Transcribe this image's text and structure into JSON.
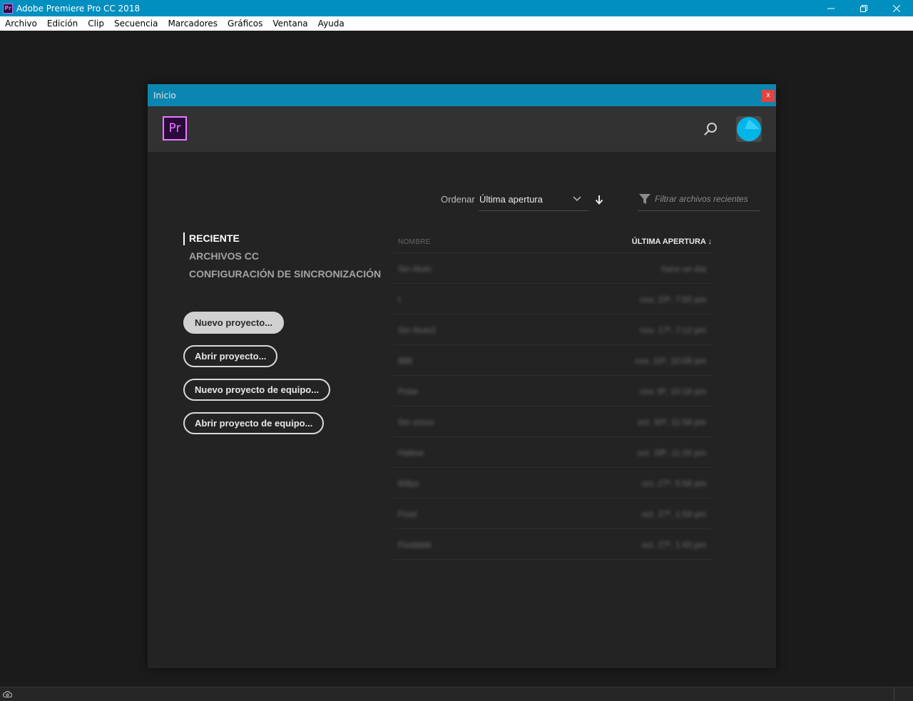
{
  "window": {
    "title": "Adobe Premiere Pro CC 2018",
    "app_icon_label": "Pr",
    "controls": [
      "minimize-icon",
      "restore-icon",
      "close-icon"
    ]
  },
  "menu": [
    "Archivo",
    "Edición",
    "Clip",
    "Secuencia",
    "Marcadores",
    "Gráficos",
    "Ventana",
    "Ayuda"
  ],
  "dialog": {
    "title": "Inicio",
    "close_label": "x",
    "logo_label": "Pr",
    "sort": {
      "label": "Ordenar",
      "value": "Última apertura"
    },
    "filter": {
      "placeholder": "Filtrar archivos recientes"
    },
    "nav": [
      "RECIENTE",
      "ARCHIVOS CC",
      "CONFIGURACIÓN DE SINCRONIZACIÓN"
    ],
    "buttons": [
      "Nuevo proyecto...",
      "Abrir proyecto...",
      "Nuevo proyecto de equipo...",
      "Abrir proyecto de equipo..."
    ],
    "table": {
      "col_name": "NOMBRE",
      "col_date": "ÚLTIMA APERTURA ↓",
      "rows": [
        {
          "name": "Sin título",
          "date": "hace un día"
        },
        {
          "name": "t",
          "date": "nov. 23ª, 7:50 pm"
        },
        {
          "name": "Sin título2",
          "date": "nov. 17ª, 7:12 pm"
        },
        {
          "name": "888",
          "date": "nov. 10ª, 10:09 pm"
        },
        {
          "name": "Polar",
          "date": "nov. 8ª, 10:18 pm"
        },
        {
          "name": "Sin xxxxx",
          "date": "oct. 30ª, 11:58 pm"
        },
        {
          "name": "Hallow",
          "date": "oct. 28ª, 11:26 pm"
        },
        {
          "name": "60fps",
          "date": "oct. 27ª, 5:58 pm"
        },
        {
          "name": "Fluid",
          "date": "oct. 27ª, 1:59 pm"
        },
        {
          "name": "Fluidddd",
          "date": "oct. 27ª, 1:43 pm"
        }
      ]
    }
  },
  "colors": {
    "titlebar": "#008fbf",
    "dialog_title": "#0b86b0",
    "premiere_purple": "#e77bff",
    "avatar": "#00b6e8"
  }
}
